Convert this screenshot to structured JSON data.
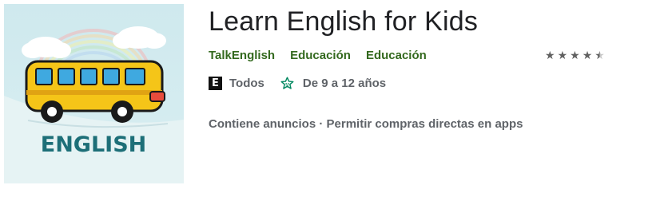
{
  "app": {
    "title": "Learn English for Kids",
    "icon_text": "ENGLISH",
    "icon_name": "school-bus-app-icon"
  },
  "meta": {
    "developer": "TalkEnglish",
    "category_primary": "Educación",
    "category_secondary": "Educación"
  },
  "rating": {
    "stars": 4.5,
    "max": 5
  },
  "content_rating": {
    "badge": "E",
    "label": "Todos"
  },
  "family": {
    "icon_name": "family-star-icon",
    "label": "De 9 a 12 años"
  },
  "features": {
    "ads": "Contiene anuncios",
    "separator": " · ",
    "iap": "Permitir compras directas en apps"
  },
  "colors": {
    "link_green": "#33691e",
    "family_green": "#01875f",
    "bus_yellow": "#f5c518",
    "icon_text_teal": "#1d6f78"
  }
}
